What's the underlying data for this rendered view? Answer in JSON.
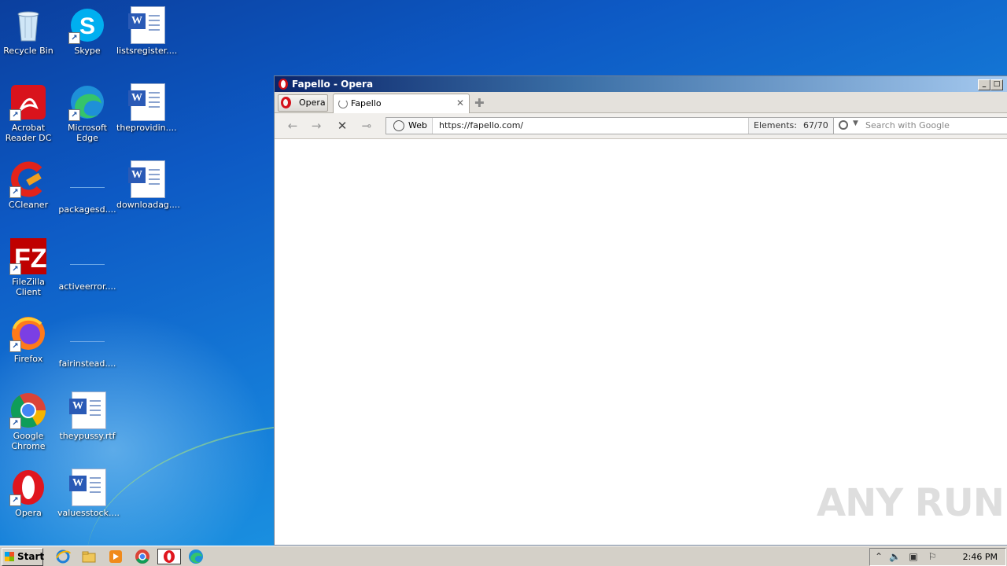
{
  "desktop": {
    "icons": [
      {
        "label": "Recycle Bin",
        "icon": "recycle-bin-icon"
      },
      {
        "label": "Skype",
        "icon": "skype-icon"
      },
      {
        "label": "listsregister....",
        "icon": "word-doc-icon"
      },
      {
        "label": "Acrobat Reader DC",
        "icon": "acrobat-icon"
      },
      {
        "label": "Microsoft Edge",
        "icon": "edge-icon"
      },
      {
        "label": "theprovidin....",
        "icon": "word-doc-icon"
      },
      {
        "label": "CCleaner",
        "icon": "ccleaner-icon"
      },
      {
        "label": "packagesd....",
        "icon": "blank-file-icon"
      },
      {
        "label": "downloadag....",
        "icon": "word-doc-icon"
      },
      {
        "label": "FileZilla Client",
        "icon": "filezilla-icon"
      },
      {
        "label": "activeerror....",
        "icon": "blank-file-icon"
      },
      {
        "label": "Firefox",
        "icon": "firefox-icon"
      },
      {
        "label": "fairinstead....",
        "icon": "blank-file-icon"
      },
      {
        "label": "Google Chrome",
        "icon": "chrome-icon"
      },
      {
        "label": "theypussy.rtf",
        "icon": "word-doc-icon"
      },
      {
        "label": "Opera",
        "icon": "opera-icon"
      },
      {
        "label": "valuesstock....",
        "icon": "word-doc-icon"
      }
    ]
  },
  "browser": {
    "window_title": "Fapello - Opera",
    "menu_label": "Opera",
    "tab_title": "Fapello",
    "web_label": "Web",
    "url": "https://fapello.com/",
    "elements_label": "Elements:",
    "elements_value": "67/70",
    "search_placeholder": "Search with Google"
  },
  "taskbar": {
    "start_label": "Start",
    "clock": "2:46 PM"
  },
  "watermark": "ANY RUN",
  "colors": {
    "desktop_blue": "#1478d6",
    "titlebar": "#0a246a",
    "opera_red": "#cc0f16"
  }
}
